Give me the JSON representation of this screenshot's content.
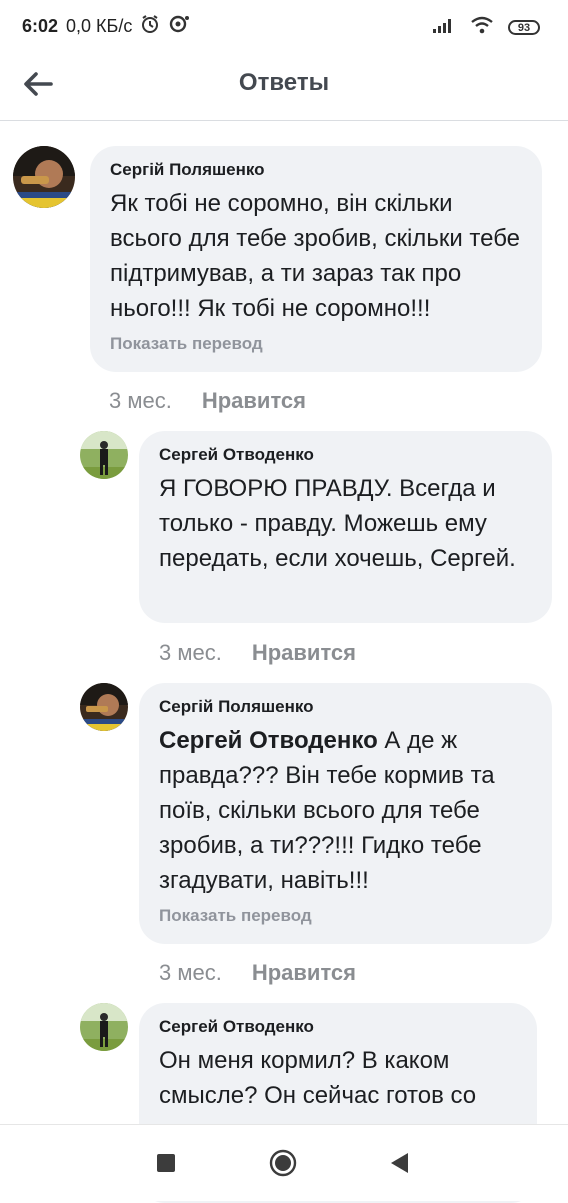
{
  "status_bar": {
    "time": "6:02",
    "speed": "0,0 КБ/с",
    "battery": "93"
  },
  "header": {
    "title": "Ответы"
  },
  "comments": [
    {
      "author": "Сергій Поляшенко",
      "text": "Як тобі не соромно, він скільки всього для тебе зробив,  скільки тебе підтримував, а ти зараз так про нього!!! Як тобі не соромно!!!",
      "translate": "Показать перевод",
      "time": "3 мес.",
      "like": "Нравится"
    },
    {
      "author": "Сергей Отводенко",
      "text": "Я ГОВОРЮ ПРАВДУ. Всегда и только - правду. Можешь ему передать, если хочешь, Сергей.",
      "time": "3 мес.",
      "like": "Нравится"
    },
    {
      "author": "Сергій Поляшенко",
      "mention": "Сергей Отводенко",
      "text": " А де ж правда??? Він тебе кормив та поїв, скільки всього для тебе зробив,  а ти???!!! Гидко тебе згадувати, навіть!!!",
      "translate": "Показать перевод",
      "time": "3 мес.",
      "like": "Нравится"
    },
    {
      "author": "Сергей Отводенко",
      "text": "Он меня кормил? В каком смысле? Он сейчас готов со"
    }
  ],
  "colors": {
    "bubble": "#f0f2f5",
    "meta": "#8a8d91"
  }
}
